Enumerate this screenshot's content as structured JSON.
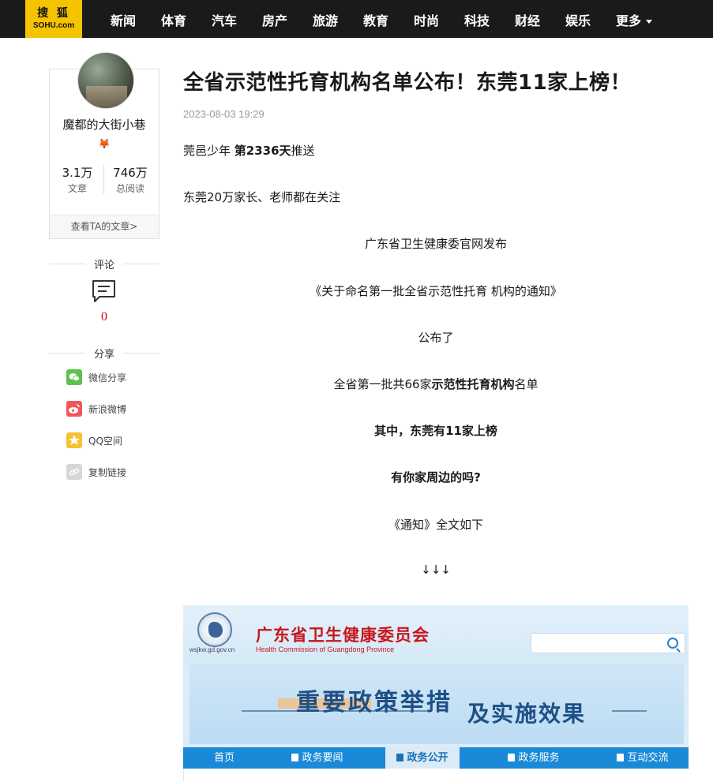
{
  "topnav": {
    "logo_cn": "搜 狐",
    "logo_en": "SOHU.com",
    "items": [
      "新闻",
      "体育",
      "汽车",
      "房产",
      "旅游",
      "教育",
      "时尚",
      "科技",
      "财经",
      "娱乐",
      "更多"
    ]
  },
  "author": {
    "name": "魔都的大街小巷",
    "badge": "fox-badge-icon",
    "stats": [
      {
        "value": "3.1万",
        "label": "文章"
      },
      {
        "value": "746万",
        "label": "总阅读"
      }
    ],
    "link": "查看TA的文章>"
  },
  "comment": {
    "title": "评论",
    "count": "0"
  },
  "share": {
    "title": "分享",
    "items": [
      {
        "label": "微信分享",
        "icon": "wechat-icon",
        "color": "#5ec14f"
      },
      {
        "label": "新浪微博",
        "icon": "weibo-icon",
        "color": "#f0565b"
      },
      {
        "label": "QQ空间",
        "icon": "qzone-icon",
        "color": "#f5c031"
      },
      {
        "label": "复制链接",
        "icon": "link-icon",
        "color": "#cfcfcf"
      }
    ]
  },
  "article": {
    "title": "全省示范性托育机构名单公布！东莞11家上榜！",
    "date": "2023-08-03 19:29",
    "p1_prefix": "莞邑少年 ",
    "p1_bold": "第2336天",
    "p1_suffix": "推送",
    "p2": "东莞20万家长、老师都在关注",
    "p3": "广东省卫生健康委官网发布",
    "p4": "《关于命名第一批全省示范性托育 机构的通知》",
    "p5": "公布了",
    "p6_prefix": "全省第一批共66家",
    "p6_bold": "示范性托育机构",
    "p6_suffix": "名单",
    "p7": "其中，东莞有11家上榜",
    "p8": "有你家周边的吗?",
    "p9": "《通知》全文如下",
    "p10": "↓↓↓"
  },
  "embed": {
    "domain": "wsjkw.gd.gov.cn",
    "org_cn": "广东省卫生健康委员会",
    "org_en": "Health Commission of Guangdong Province",
    "banner_main": "重要政策举措",
    "banner_sub": "及实施效果",
    "nav": [
      "首页",
      "政务要闻",
      "政务公开",
      "政务服务",
      "互动交流"
    ],
    "nav_active": "政务公开"
  },
  "colors": {
    "brand": "#f5c400",
    "accent_red": "#d0021b",
    "gov_blue": "#1a8ad8"
  }
}
